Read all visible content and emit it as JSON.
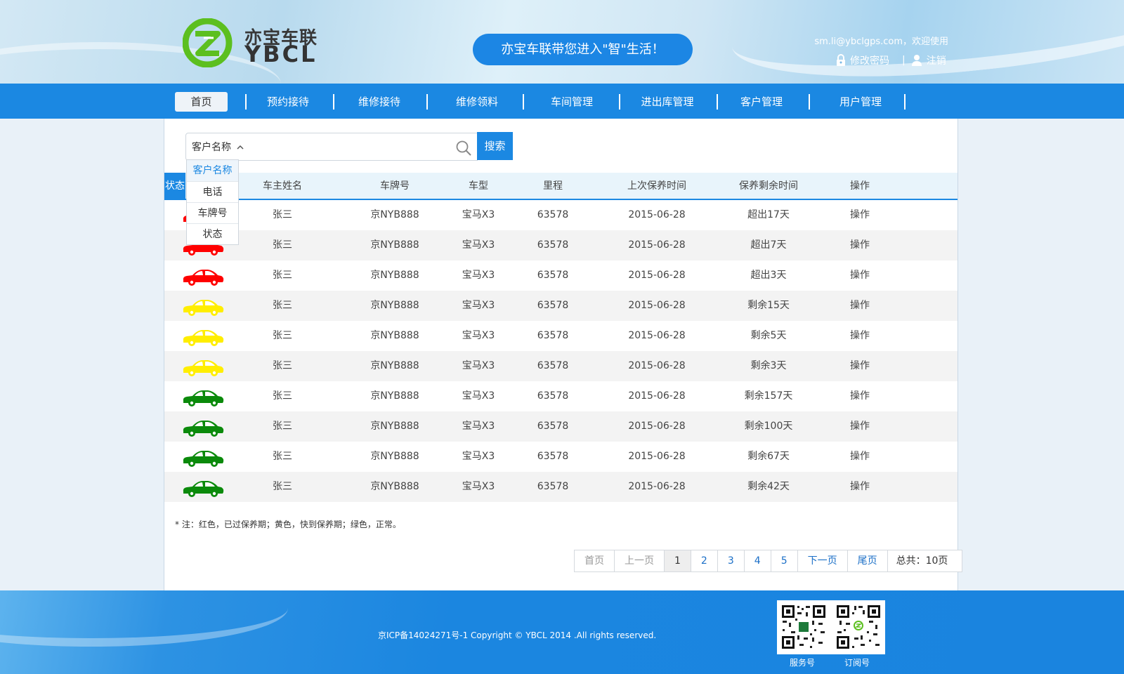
{
  "header": {
    "logo_cn": "亦宝车联",
    "logo_en": "YBCL",
    "slogan": "亦宝车联带您进入\"智\"生活！",
    "welcome": "sm.li@ybclgps.com，欢迎使用",
    "change_password": "修改密码",
    "separator": "|",
    "logout": "注销"
  },
  "nav": {
    "items": [
      {
        "label": "首页",
        "active": true
      },
      {
        "label": "预约接待"
      },
      {
        "label": "维修接待"
      },
      {
        "label": "维修领料"
      },
      {
        "label": "车间管理"
      },
      {
        "label": "进出库管理"
      },
      {
        "label": "客户管理"
      },
      {
        "label": "用户管理"
      }
    ]
  },
  "search": {
    "selected": "客户名称",
    "chevron": "^",
    "placeholder": "",
    "button": "搜索",
    "options": [
      "客户名称",
      "电话",
      "车牌号",
      "状态"
    ]
  },
  "table": {
    "columns": [
      "状态",
      "车主姓名",
      "车牌号",
      "车型",
      "里程",
      "上次保养时间",
      "保养剩余时间",
      "操作"
    ],
    "status_colors": {
      "overdue": "#ff0000",
      "soon": "#ffee00",
      "normal": "#0b8a0b"
    },
    "rows": [
      {
        "status": "overdue",
        "owner": "张三",
        "plate": "京NYB888",
        "model": "宝马X3",
        "mileage": "63578",
        "last_service": "2015-06-28",
        "remaining": "超出17天",
        "action": "操作"
      },
      {
        "status": "overdue",
        "owner": "张三",
        "plate": "京NYB888",
        "model": "宝马X3",
        "mileage": "63578",
        "last_service": "2015-06-28",
        "remaining": "超出7天",
        "action": "操作"
      },
      {
        "status": "overdue",
        "owner": "张三",
        "plate": "京NYB888",
        "model": "宝马X3",
        "mileage": "63578",
        "last_service": "2015-06-28",
        "remaining": "超出3天",
        "action": "操作"
      },
      {
        "status": "soon",
        "owner": "张三",
        "plate": "京NYB888",
        "model": "宝马X3",
        "mileage": "63578",
        "last_service": "2015-06-28",
        "remaining": "剩余15天",
        "action": "操作"
      },
      {
        "status": "soon",
        "owner": "张三",
        "plate": "京NYB888",
        "model": "宝马X3",
        "mileage": "63578",
        "last_service": "2015-06-28",
        "remaining": "剩余5天",
        "action": "操作"
      },
      {
        "status": "soon",
        "owner": "张三",
        "plate": "京NYB888",
        "model": "宝马X3",
        "mileage": "63578",
        "last_service": "2015-06-28",
        "remaining": "剩余3天",
        "action": "操作"
      },
      {
        "status": "normal",
        "owner": "张三",
        "plate": "京NYB888",
        "model": "宝马X3",
        "mileage": "63578",
        "last_service": "2015-06-28",
        "remaining": "剩余157天",
        "action": "操作"
      },
      {
        "status": "normal",
        "owner": "张三",
        "plate": "京NYB888",
        "model": "宝马X3",
        "mileage": "63578",
        "last_service": "2015-06-28",
        "remaining": "剩余100天",
        "action": "操作"
      },
      {
        "status": "normal",
        "owner": "张三",
        "plate": "京NYB888",
        "model": "宝马X3",
        "mileage": "63578",
        "last_service": "2015-06-28",
        "remaining": "剩余67天",
        "action": "操作"
      },
      {
        "status": "normal",
        "owner": "张三",
        "plate": "京NYB888",
        "model": "宝马X3",
        "mileage": "63578",
        "last_service": "2015-06-28",
        "remaining": "剩余42天",
        "action": "操作"
      }
    ]
  },
  "note": "* 注：红色，已过保养期；黄色，快到保养期；绿色，正常。",
  "pager": {
    "first": "首页",
    "prev": "上一页",
    "pages": [
      "1",
      "2",
      "3",
      "4",
      "5"
    ],
    "current": "1",
    "next": "下一页",
    "last": "尾页",
    "total": "总共：10页"
  },
  "footer": {
    "copyright": "京ICP备14024271号-1 Copyright © YBCL 2014 .All rights reserved.",
    "qr_service_label": "服务号",
    "qr_subscribe_label": "订阅号"
  },
  "colors": {
    "brand": "#1b88e2",
    "logo_green": "#5cbf1f"
  }
}
